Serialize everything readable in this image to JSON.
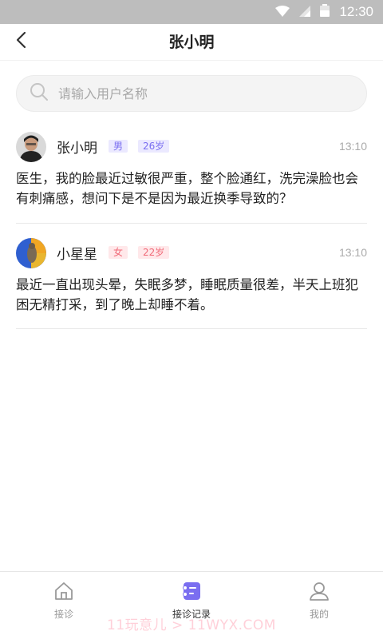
{
  "status_bar": {
    "time": "12:30",
    "icons": [
      "wifi-icon",
      "signal-icon",
      "battery-icon"
    ]
  },
  "header": {
    "title": "张小明",
    "back_icon": "chevron-left-icon"
  },
  "search": {
    "placeholder": "请输入用户名称",
    "value": ""
  },
  "records": [
    {
      "name": "张小明",
      "gender": "男",
      "age": "26岁",
      "time": "13:10",
      "content": "医生，我的脸最近过敏很严重，整个脸通红，洗完澡脸也会有刺痛感，想问下是不是因为最近换季导致的？"
    },
    {
      "name": "小星星",
      "gender": "女",
      "age": "22岁",
      "time": "13:10",
      "content": "最近一直出现头晕，失眠多梦，睡眠质量很差，半天上班犯困无精打采，到了晚上却睡不着。"
    }
  ],
  "tabbar": {
    "tabs": [
      {
        "label": "接诊",
        "icon": "home-icon",
        "active": false
      },
      {
        "label": "接诊记录",
        "icon": "records-icon",
        "active": true
      },
      {
        "label": "我的",
        "icon": "profile-icon",
        "active": false
      }
    ]
  },
  "watermark": "11玩意儿 > 11WYX.COM",
  "colors": {
    "accent": "#7a6ef0",
    "female_tag": "#f06a78",
    "status_bar": "#bdbdbd"
  }
}
